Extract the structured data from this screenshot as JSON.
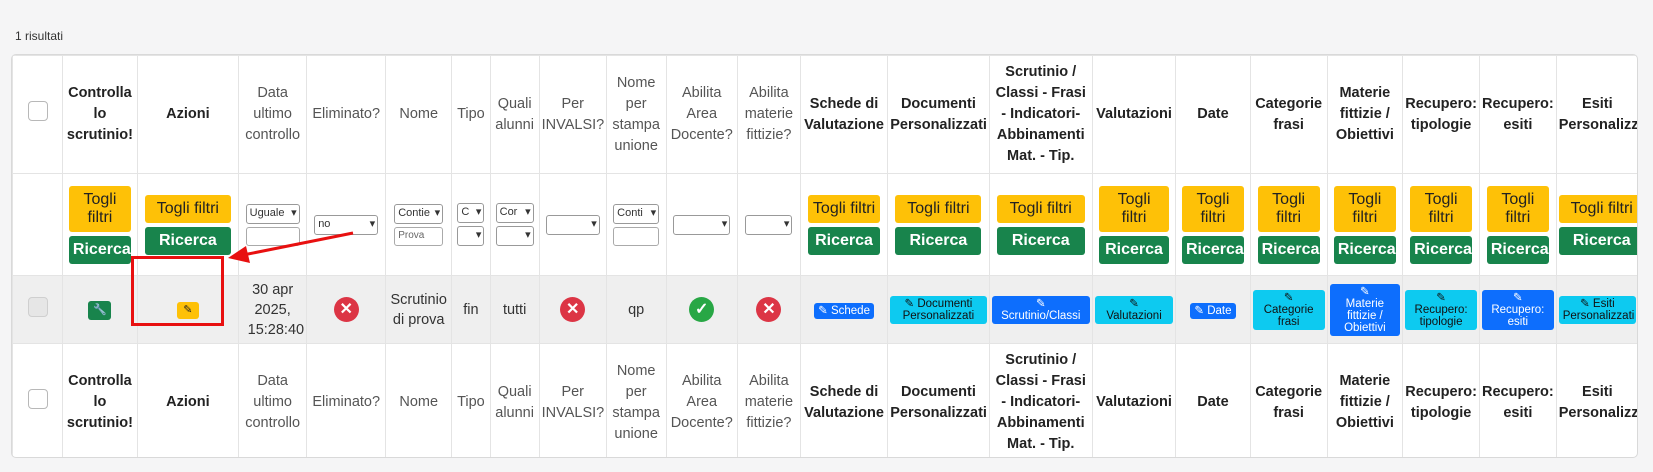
{
  "results_count": "1 risultati",
  "columns": [
    {
      "label": "Controlla lo scrutinio!",
      "bold": true
    },
    {
      "label": "Azioni",
      "bold": true
    },
    {
      "label": "Data ultimo controllo",
      "bold": false
    },
    {
      "label": "Eliminato?",
      "bold": false
    },
    {
      "label": "Nome",
      "bold": false
    },
    {
      "label": "Tipo",
      "bold": false
    },
    {
      "label": "Quali alunni",
      "bold": false
    },
    {
      "label": "Per INVALSI?",
      "bold": false
    },
    {
      "label": "Nome per stampa unione",
      "bold": false
    },
    {
      "label": "Abilita Area Docente?",
      "bold": false
    },
    {
      "label": "Abilita materie fittizie?",
      "bold": false
    },
    {
      "label": "Schede di Valutazione",
      "bold": true
    },
    {
      "label": "Documenti Personalizzati",
      "bold": true
    },
    {
      "label": "Scrutinio / Classi - Frasi - Indicatori- Abbinamenti Mat. - Tip.",
      "bold": true
    },
    {
      "label": "Valutazioni",
      "bold": true
    },
    {
      "label": "Date",
      "bold": true
    },
    {
      "label": "Categorie frasi",
      "bold": true
    },
    {
      "label": "Materie fittizie / Obiettivi",
      "bold": true
    },
    {
      "label": "Recupero: tipologie",
      "bold": true
    },
    {
      "label": "Recupero: esiti",
      "bold": true
    },
    {
      "label": "Esiti Personalizzati",
      "bold": true
    }
  ],
  "filters": {
    "reset": "Togli filtri",
    "search": "Ricerca",
    "data_op": "Uguale",
    "eliminato": "no",
    "nome_op": "Contie",
    "nome_value": "Prova",
    "tipo_op": "C",
    "quali_op": "Cor",
    "stampa_op": "Conti"
  },
  "row": {
    "date": "30 apr 2025, 15:28:40",
    "nome": "Scrutinio di prova",
    "tipo": "fin",
    "quali": "tutti",
    "stampa": "qp",
    "btn_schede": "Schede",
    "btn_documenti": "Documenti Personalizzati",
    "btn_scrutinio": "Scrutinio/Classi",
    "btn_valutazioni": "Valutazioni",
    "btn_date": "Date",
    "btn_categorie": "Categorie frasi",
    "btn_materie": "Materie fittizie / Obiettivi",
    "btn_rec_tip": "Recupero: tipologie",
    "btn_rec_esiti": "Recupero: esiti",
    "btn_esiti": "Esiti Personalizzati"
  },
  "footer_columns": [
    {
      "label": "Controlla lo scrutinio!",
      "bold": true
    },
    {
      "label": "Azioni",
      "bold": true
    },
    {
      "label": "Data ultimo controllo",
      "bold": false
    },
    {
      "label": "Eliminato?",
      "bold": false
    },
    {
      "label": "Nome",
      "bold": false
    },
    {
      "label": "Tipo",
      "bold": false
    },
    {
      "label": "Quali alunni",
      "bold": false
    },
    {
      "label": "Per INVALSI?",
      "bold": false
    },
    {
      "label": "Nome per stampa unione",
      "bold": false
    },
    {
      "label": "Abilita Area Docente?",
      "bold": false
    },
    {
      "label": "Abilita materie fittizie?",
      "bold": false
    },
    {
      "label": "Schede di Valutazione",
      "bold": true
    },
    {
      "label": "Documenti Personalizzati",
      "bold": true
    },
    {
      "label": "Scrutinio / Classi - Frasi - Indicatori- Abbinamenti Mat. - Tip.",
      "bold": true
    },
    {
      "label": "Valutazioni",
      "bold": true
    },
    {
      "label": "Date",
      "bold": true
    },
    {
      "label": "Categorie frasi",
      "bold": true
    },
    {
      "label": "Materie fittizie / Obiettivi",
      "bold": true
    },
    {
      "label": "Recupero: tipologie",
      "bold": true
    },
    {
      "label": "Recupero: esiti",
      "bold": true
    },
    {
      "label": "Esiti Personalizzati",
      "bold": true
    }
  ]
}
